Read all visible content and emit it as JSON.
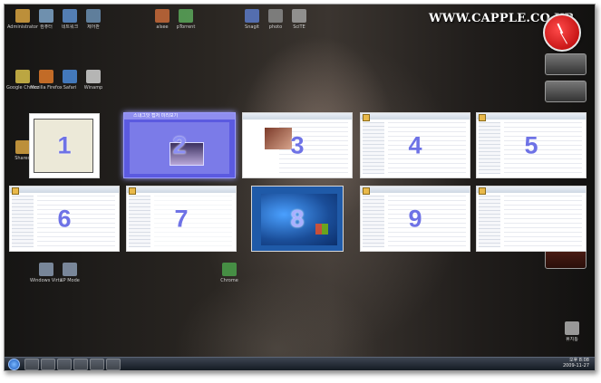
{
  "watermark": "WWW.CAPPLE.CO.KR",
  "window_thumbnails": [
    {
      "number": "1",
      "title": "",
      "active": false
    },
    {
      "number": "2",
      "title": "스내그잇 캡처 미리보기",
      "active": true
    },
    {
      "number": "3",
      "title": "",
      "active": false
    },
    {
      "number": "4",
      "title": "",
      "active": false
    },
    {
      "number": "5",
      "title": "",
      "active": false
    },
    {
      "number": "6",
      "title": "",
      "active": false
    },
    {
      "number": "7",
      "title": "",
      "active": false
    },
    {
      "number": "8",
      "title": "",
      "active": false
    },
    {
      "number": "9",
      "title": "",
      "active": false
    },
    {
      "number": "",
      "title": "",
      "active": false
    }
  ],
  "desktop_icons": [
    {
      "label": "Administrator",
      "color": "#d9a441"
    },
    {
      "label": "컴퓨터",
      "color": "#7fa6c9"
    },
    {
      "label": "네트워크",
      "color": "#5d8fcf"
    },
    {
      "label": "제어판",
      "color": "#6b8fb3"
    },
    {
      "label": "alsee",
      "color": "#c86a3a"
    },
    {
      "label": "pTorrent",
      "color": "#5aa85a"
    },
    {
      "label": "Snagit",
      "color": "#5b7ac8"
    },
    {
      "label": "photo",
      "color": "#8a8a8a"
    },
    {
      "label": "SciTE",
      "color": "#a0a0a0"
    },
    {
      "label": "Google Chrome",
      "color": "#d8c04a"
    },
    {
      "label": "Mozilla Firefox",
      "color": "#e07a2a"
    },
    {
      "label": "Safari",
      "color": "#4a8ad8"
    },
    {
      "label": "Winamp",
      "color": "#d0d0d0"
    },
    {
      "label": "Shared",
      "color": "#d9a441"
    },
    {
      "label": "Windows Virtual PC",
      "color": "#8a9ab0"
    },
    {
      "label": "XP Mode",
      "color": "#8a9ab0"
    },
    {
      "label": "Chrome",
      "color": "#4aa04a"
    },
    {
      "label": "휴지통",
      "color": "#b0b0b0"
    }
  ],
  "taskbar": {
    "clock_time": "오후 8:08",
    "clock_date": "2009-11-27"
  }
}
